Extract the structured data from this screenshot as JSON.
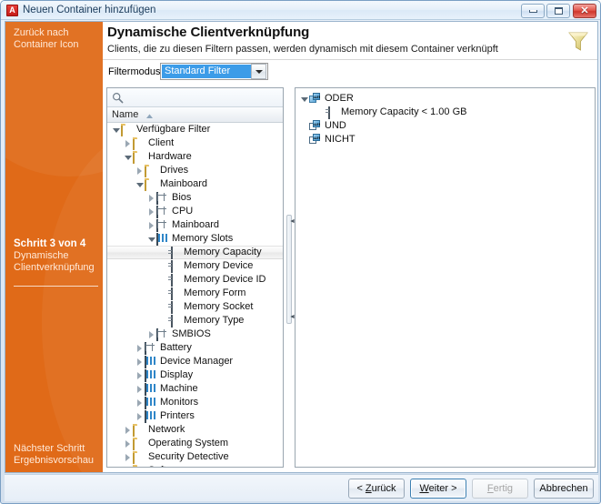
{
  "window": {
    "title": "Neuen Container hinzufügen",
    "icon": "app-icon-a",
    "icon_letter": "A",
    "controls": {
      "minimize": "minimize-icon",
      "maximize": "maximize-icon",
      "close": "close-icon"
    }
  },
  "sidebar": {
    "back_link_line1": "Zurück nach",
    "back_link_line2": "Container Icon",
    "step_title": "Schritt 3 von 4",
    "step_sub_line1": "Dynamische",
    "step_sub_line2": "Clientverknüpfung",
    "next_step_line1": "Nächster Schritt",
    "next_step_line2": "Ergebnisvorschau",
    "accent_color": "#e06a18"
  },
  "header": {
    "title": "Dynamische Clientverknüpfung",
    "subtitle": "Clients, die zu diesen Filtern passen, werden dynamisch mit diesem Container verknüpft",
    "icon": "funnel-icon"
  },
  "filtermode": {
    "label": "Filtermodus:",
    "value": "Standard Filter",
    "options": [
      "Standard Filter"
    ],
    "highlight_color": "#3c9ce8"
  },
  "left_panel": {
    "search_placeholder": "",
    "search_value": "",
    "search_icon": "magnifier-icon",
    "column_header": "Name",
    "sort_direction": "ascending",
    "tree": [
      {
        "label": "Verfügbare Filter",
        "depth": 0,
        "icon": "folder",
        "state": "expanded",
        "selected": false
      },
      {
        "label": "Client",
        "depth": 1,
        "icon": "folder",
        "state": "collapsed",
        "selected": false
      },
      {
        "label": "Hardware",
        "depth": 1,
        "icon": "folder",
        "state": "expanded",
        "selected": false
      },
      {
        "label": "Drives",
        "depth": 2,
        "icon": "folder",
        "state": "collapsed",
        "selected": false
      },
      {
        "label": "Mainboard",
        "depth": 2,
        "icon": "folder",
        "state": "expanded",
        "selected": false
      },
      {
        "label": "Bios",
        "depth": 3,
        "icon": "grid",
        "state": "collapsed",
        "selected": false
      },
      {
        "label": "CPU",
        "depth": 3,
        "icon": "grid",
        "state": "collapsed",
        "selected": false
      },
      {
        "label": "Mainboard",
        "depth": 3,
        "icon": "grid",
        "state": "collapsed",
        "selected": false
      },
      {
        "label": "Memory Slots",
        "depth": 3,
        "icon": "grid-blue",
        "state": "expanded",
        "selected": false
      },
      {
        "label": "Memory Capacity",
        "depth": 4,
        "icon": "attr",
        "state": "leaf",
        "selected": true
      },
      {
        "label": "Memory Device",
        "depth": 4,
        "icon": "attr",
        "state": "leaf",
        "selected": false
      },
      {
        "label": "Memory Device ID",
        "depth": 4,
        "icon": "attr",
        "state": "leaf",
        "selected": false
      },
      {
        "label": "Memory Form",
        "depth": 4,
        "icon": "attr",
        "state": "leaf",
        "selected": false
      },
      {
        "label": "Memory Socket",
        "depth": 4,
        "icon": "attr",
        "state": "leaf",
        "selected": false
      },
      {
        "label": "Memory Type",
        "depth": 4,
        "icon": "attr",
        "state": "leaf",
        "selected": false
      },
      {
        "label": "SMBIOS",
        "depth": 3,
        "icon": "grid",
        "state": "collapsed",
        "selected": false
      },
      {
        "label": "Battery",
        "depth": 2,
        "icon": "grid",
        "state": "collapsed",
        "selected": false
      },
      {
        "label": "Device Manager",
        "depth": 2,
        "icon": "grid-blue",
        "state": "collapsed",
        "selected": false
      },
      {
        "label": "Display",
        "depth": 2,
        "icon": "grid-blue",
        "state": "collapsed",
        "selected": false
      },
      {
        "label": "Machine",
        "depth": 2,
        "icon": "grid-blue",
        "state": "collapsed",
        "selected": false
      },
      {
        "label": "Monitors",
        "depth": 2,
        "icon": "grid-blue",
        "state": "collapsed",
        "selected": false
      },
      {
        "label": "Printers",
        "depth": 2,
        "icon": "grid-blue",
        "state": "collapsed",
        "selected": false
      },
      {
        "label": "Network",
        "depth": 1,
        "icon": "folder",
        "state": "collapsed",
        "selected": false
      },
      {
        "label": "Operating System",
        "depth": 1,
        "icon": "folder",
        "state": "collapsed",
        "selected": false
      },
      {
        "label": "Security Detective",
        "depth": 1,
        "icon": "folder",
        "state": "collapsed",
        "selected": false
      },
      {
        "label": "Software",
        "depth": 1,
        "icon": "folder",
        "state": "collapsed",
        "selected": false
      }
    ]
  },
  "right_panel": {
    "tree": [
      {
        "label": "ODER",
        "depth": 0,
        "icon": "logic-or",
        "state": "expanded",
        "selected": false
      },
      {
        "label": "Memory Capacity < 1.00 GB",
        "depth": 1,
        "icon": "attr",
        "state": "leaf",
        "selected": false
      },
      {
        "label": "UND",
        "depth": 0,
        "icon": "logic-and",
        "state": "leaf",
        "selected": false
      },
      {
        "label": "NICHT",
        "depth": 0,
        "icon": "logic-not",
        "state": "leaf",
        "selected": false
      }
    ]
  },
  "buttons": {
    "back": "< Zurück",
    "next": "Weiter >",
    "finish": "Fertig",
    "cancel": "Abbrechen",
    "finish_disabled": true,
    "default_button": "next"
  }
}
